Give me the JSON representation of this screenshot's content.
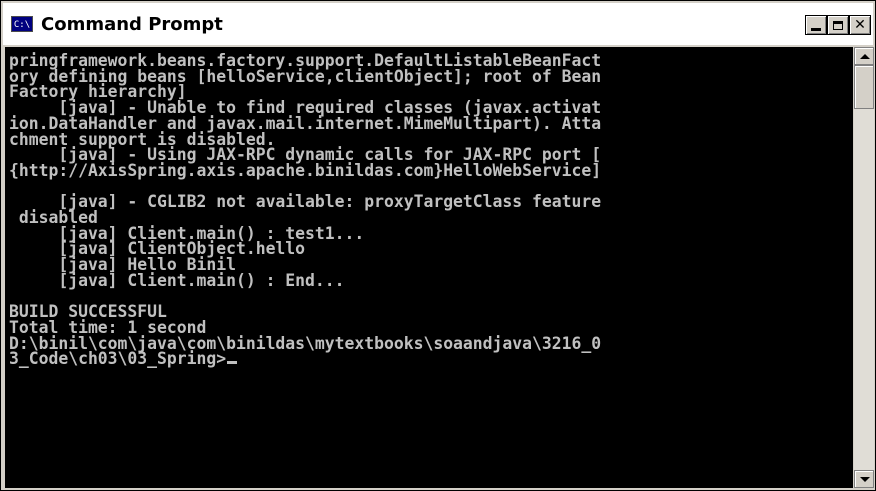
{
  "window": {
    "title": "Command Prompt",
    "icon": "cmd-icon",
    "icon_text": "C:\\",
    "controls": {
      "minimize_icon": "minimize-icon",
      "maximize_icon": "maximize-icon",
      "close_icon": "close-icon",
      "close_glyph": "✕"
    }
  },
  "console": {
    "background": "#000000",
    "foreground": "#c0c0c0",
    "lines": [
      "pringframework.beans.factory.support.DefaultListableBeanFact",
      "ory defining beans [helloService,clientObject]; root of Bean",
      "Factory hierarchy]",
      "     [java] - Unable to find required classes (javax.activat",
      "ion.DataHandler and javax.mail.internet.MimeMultipart). Atta",
      "chment support is disabled.",
      "     [java] - Using JAX-RPC dynamic calls for JAX-RPC port [",
      "{http://AxisSpring.axis.apache.binildas.com}HelloWebService]",
      "",
      "     [java] - CGLIB2 not available: proxyTargetClass feature",
      " disabled",
      "     [java] Client.main() : test1...",
      "     [java] ClientObject.hello",
      "     [java] Hello Binil",
      "     [java] Client.main() : End...",
      "",
      "BUILD SUCCESSFUL",
      "Total time: 1 second",
      "D:\\binil\\com\\java\\com\\binildas\\mytextbooks\\soaandjava\\3216_0",
      "3_Code\\ch03\\03_Spring>"
    ]
  },
  "scrollbar": {
    "up_icon": "scroll-up-arrow-icon",
    "down_icon": "scroll-down-arrow-icon"
  }
}
